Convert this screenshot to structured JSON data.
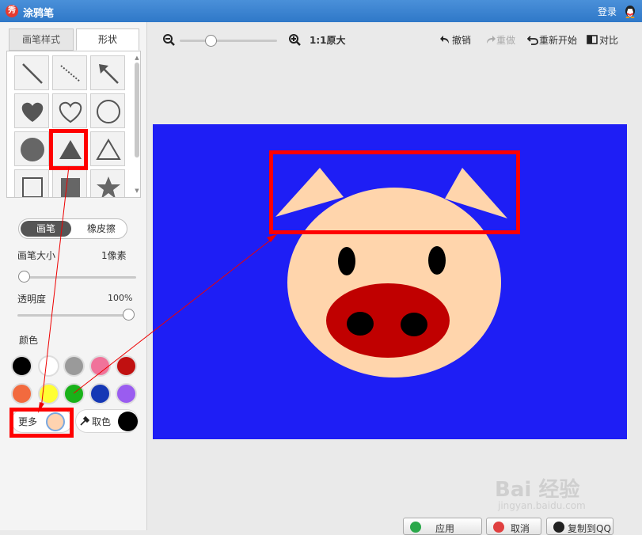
{
  "app": {
    "logo_text": "秀",
    "title": "涂鸦笔",
    "login": "登录"
  },
  "tabs": {
    "brush_style": "画笔样式",
    "shape": "形状"
  },
  "shapes": [
    "line-icon",
    "dashed-line-icon",
    "arrow-icon",
    "filled-heart-icon",
    "outline-heart-icon",
    "outline-circle-icon",
    "filled-circle-icon",
    "filled-triangle-icon",
    "outline-triangle-icon",
    "outline-square-icon",
    "filled-square-icon",
    "star-icon"
  ],
  "mode": {
    "brush": "画笔",
    "eraser": "橡皮擦"
  },
  "brush_size": {
    "label": "画笔大小",
    "value": "1像素",
    "level": 0.0
  },
  "opacity": {
    "label": "透明度",
    "value": "100%",
    "level": 1.0
  },
  "color_label": "颜色",
  "palette": [
    "#000000",
    "#ffffff",
    "#9a9a9a",
    "#f0739a",
    "#c01010",
    "#f26a3e",
    "#ffff33",
    "#19b219",
    "#1538b5",
    "#9a5cf0"
  ],
  "more": {
    "label": "更多",
    "color": "#ffd3b0"
  },
  "pick": {
    "label": "取色",
    "color": "#000000"
  },
  "toolbar": {
    "zoom_label": "1:1原大",
    "undo": "撤销",
    "redo": "重做",
    "restart": "重新开始",
    "compare": "对比",
    "zoom_level": 0.3
  },
  "canvas": {
    "background": "#1e1ef5",
    "pig_skin": "#ffd5ac",
    "nose": "#c00000",
    "eyes": "#000000"
  },
  "buttons": {
    "apply": "应用",
    "cancel": "取消",
    "copy": "复制到QQ"
  },
  "watermark": {
    "main": "Bai  经验",
    "sub": "jingyan.baidu.com"
  }
}
